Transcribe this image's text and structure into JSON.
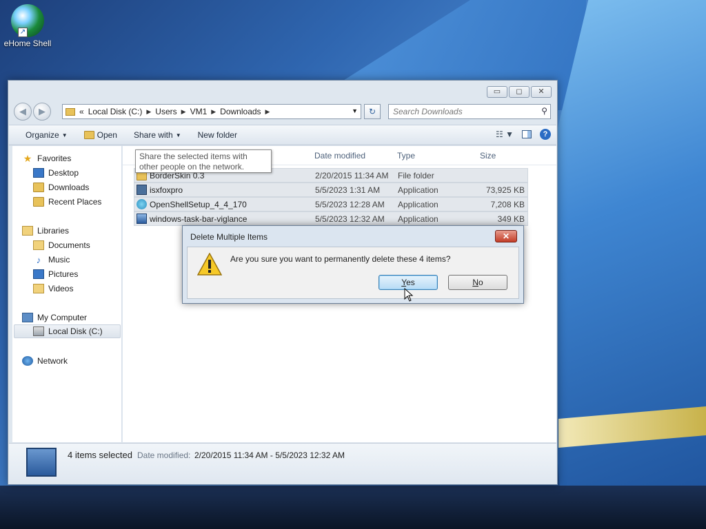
{
  "desktop": {
    "icon_label": "eHome Shell"
  },
  "window": {
    "caption": {
      "minimize": "▭",
      "maximize": "◻",
      "close": "✕"
    },
    "address": {
      "overflow": "«",
      "crumbs": [
        "Local Disk (C:)",
        "Users",
        "VM1",
        "Downloads"
      ],
      "refresh": "↻"
    },
    "search": {
      "placeholder": "Search Downloads"
    },
    "toolbar": {
      "organize": "Organize",
      "open": "Open",
      "share_with": "Share with",
      "new_folder": "New folder"
    },
    "nav": {
      "favorites": "Favorites",
      "desktop": "Desktop",
      "downloads": "Downloads",
      "recent_places": "Recent Places",
      "libraries": "Libraries",
      "documents": "Documents",
      "music": "Music",
      "pictures": "Pictures",
      "videos": "Videos",
      "my_computer": "My Computer",
      "local_disk": "Local Disk (C:)",
      "network": "Network"
    },
    "columns": {
      "date_modified": "Date modified",
      "type": "Type",
      "size": "Size"
    },
    "files": [
      {
        "name": "BorderSkin 0.3",
        "date": "2/20/2015 11:34 AM",
        "type": "File folder",
        "size": ""
      },
      {
        "name": "isxfoxpro",
        "date": "5/5/2023 1:31 AM",
        "type": "Application",
        "size": "73,925 KB"
      },
      {
        "name": "OpenShellSetup_4_4_170",
        "date": "5/5/2023 12:28 AM",
        "type": "Application",
        "size": "7,208 KB"
      },
      {
        "name": "windows-task-bar-viglance",
        "date": "5/5/2023 12:32 AM",
        "type": "Application",
        "size": "349 KB"
      }
    ],
    "tooltip": "Share the selected items with other people on the network.",
    "details": {
      "count": "4 items selected",
      "date_label": "Date modified:",
      "date_value": "2/20/2015 11:34 AM - 5/5/2023 12:32 AM"
    }
  },
  "dialog": {
    "title": "Delete Multiple Items",
    "close": "✕",
    "message": "Are you sure you want to permanently delete these 4 items?",
    "yes_prefix": "",
    "yes_underlined": "Y",
    "yes_rest": "es",
    "no_underlined": "N",
    "no_rest": "o"
  }
}
